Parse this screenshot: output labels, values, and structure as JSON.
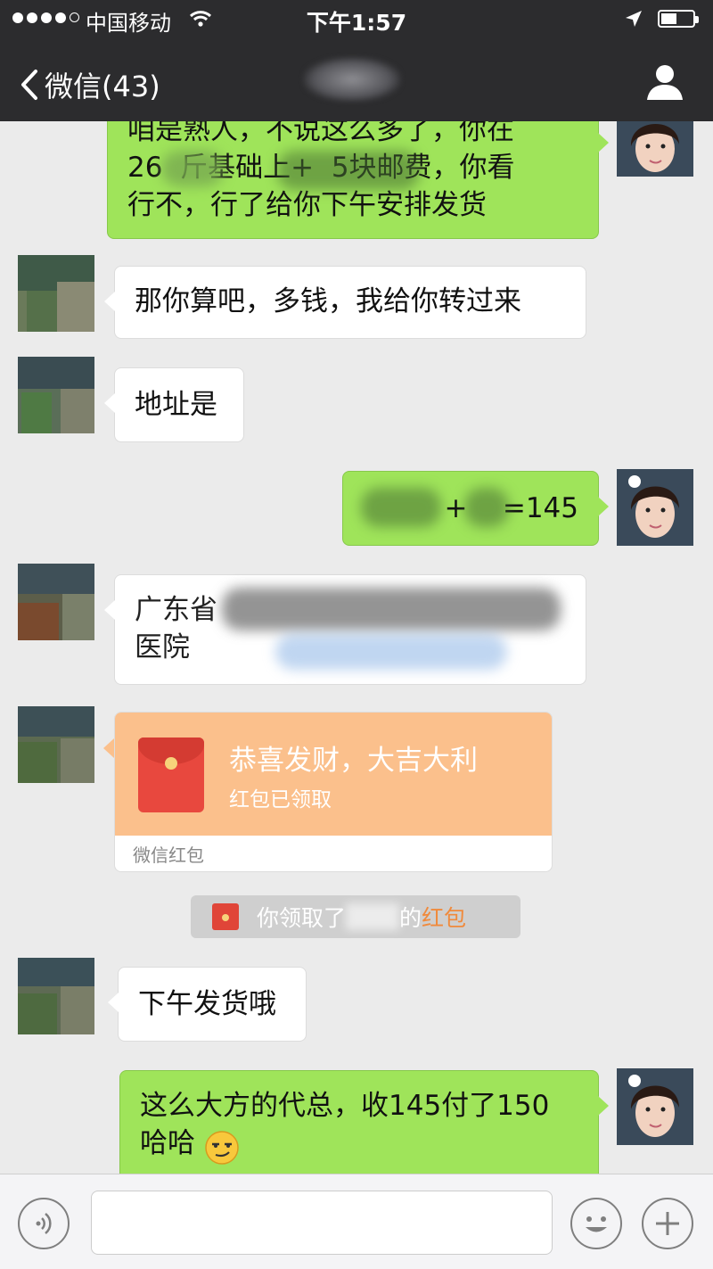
{
  "status_bar": {
    "carrier": "中国移动",
    "time": "下午1:57"
  },
  "nav": {
    "back_label": "微信(43)"
  },
  "messages": [
    {
      "side": "right",
      "text": "咱是熟人，不说这么多了，你在\n26  斤基础上+  5块邮费，你看\n行不，行了给你下午安排发货"
    },
    {
      "side": "left",
      "text": "那你算吧，多钱，我给你转过来"
    },
    {
      "side": "left",
      "text": "地址是"
    },
    {
      "side": "right",
      "text": "        +    =145"
    },
    {
      "side": "left",
      "text": "广东省                        \n医院"
    },
    {
      "side": "left",
      "text": "下午发货哦"
    },
    {
      "side": "right",
      "text": "这么大方的代总，收145付了150\n哈哈"
    }
  ],
  "red_packet": {
    "title": "恭喜发财，大吉大利",
    "status": "红包已领取",
    "footer": "微信红包"
  },
  "system_message": {
    "prefix": "你领取了",
    "middle": "的",
    "highlight": "红包"
  },
  "colors": {
    "nav_bg": "#2c2c2e",
    "chat_bg": "#ebebeb",
    "green_bubble": "#9fe45a",
    "red_packet": "#fbc08c",
    "highlight": "#f08a3c"
  },
  "icons": [
    "back-chevron-icon",
    "profile-icon",
    "voice-icon",
    "emoji-icon",
    "plus-icon",
    "red-packet-icon",
    "location-arrow-icon",
    "wifi-icon",
    "battery-icon"
  ]
}
